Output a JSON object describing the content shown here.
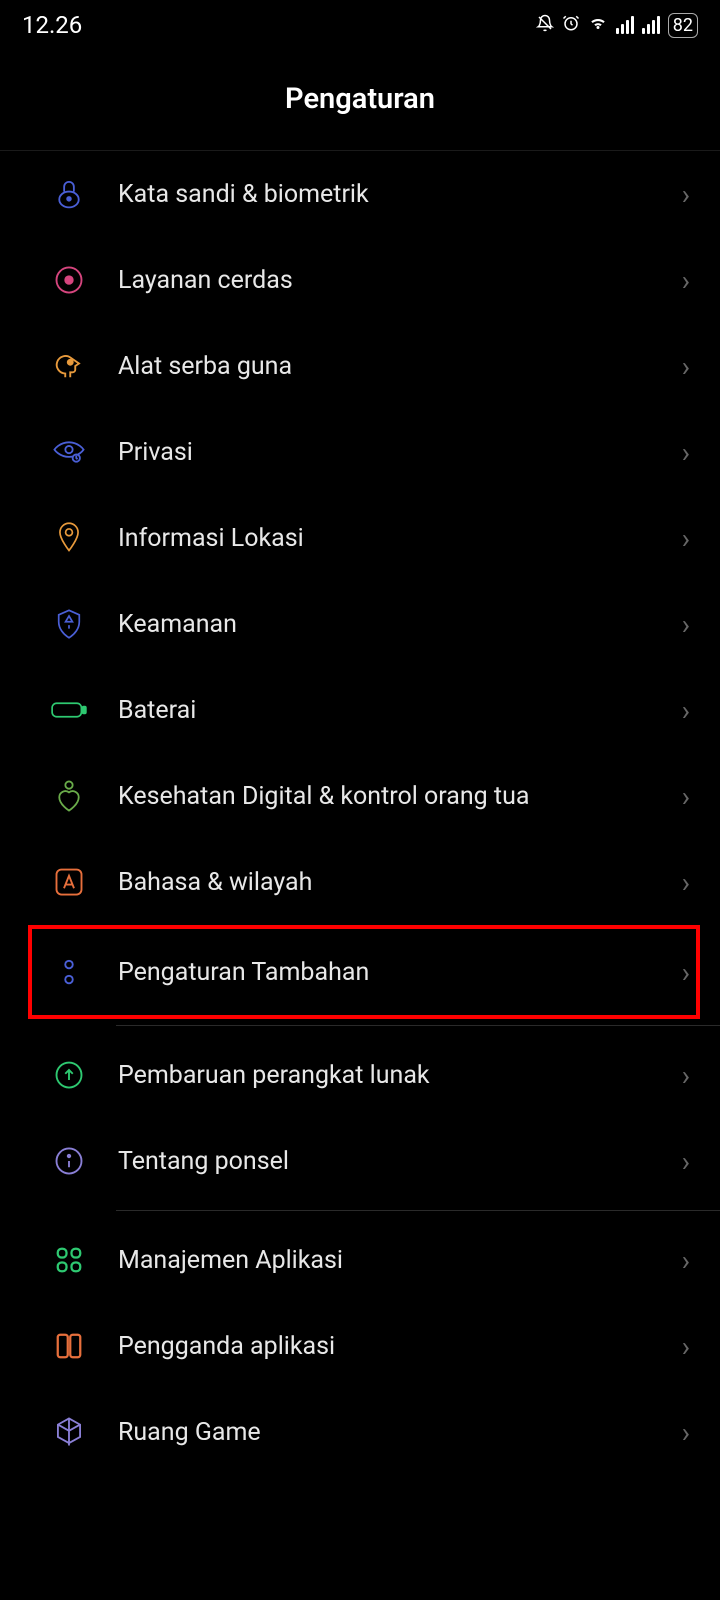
{
  "status": {
    "time": "12.26",
    "battery": "82"
  },
  "header": {
    "title": "Pengaturan"
  },
  "items": [
    {
      "label": "Kata sandi & biometrik",
      "icon": "lock-icon",
      "color": "#4a5fd6"
    },
    {
      "label": "Layanan cerdas",
      "icon": "record-icon",
      "color": "#d6457e"
    },
    {
      "label": "Alat serba guna",
      "icon": "head-icon",
      "color": "#e89a3c"
    },
    {
      "label": "Privasi",
      "icon": "eye-icon",
      "color": "#4a5fd6"
    },
    {
      "label": "Informasi Lokasi",
      "icon": "location-icon",
      "color": "#e89a3c"
    },
    {
      "label": "Keamanan",
      "icon": "shield-icon",
      "color": "#4a5fd6"
    },
    {
      "label": "Baterai",
      "icon": "battery-icon",
      "color": "#2ec971"
    },
    {
      "label": "Kesehatan Digital & kontrol orang tua",
      "icon": "heart-person-icon",
      "color": "#6aac4a"
    },
    {
      "label": "Bahasa & wilayah",
      "icon": "letter-icon",
      "color": "#e76f3c"
    },
    {
      "label": "Pengaturan Tambahan",
      "icon": "dots-icon",
      "color": "#4a5fd6",
      "highlighted": true
    }
  ],
  "group2": [
    {
      "label": "Pembaruan perangkat lunak",
      "icon": "update-icon",
      "color": "#2ec971"
    },
    {
      "label": "Tentang ponsel",
      "icon": "info-icon",
      "color": "#8a7fd6"
    }
  ],
  "group3": [
    {
      "label": "Manajemen Aplikasi",
      "icon": "grid-icon",
      "color": "#2ec971"
    },
    {
      "label": "Pengganda aplikasi",
      "icon": "duplicate-icon",
      "color": "#e76f3c"
    },
    {
      "label": "Ruang Game",
      "icon": "cube-icon",
      "color": "#8a7fd6"
    }
  ]
}
